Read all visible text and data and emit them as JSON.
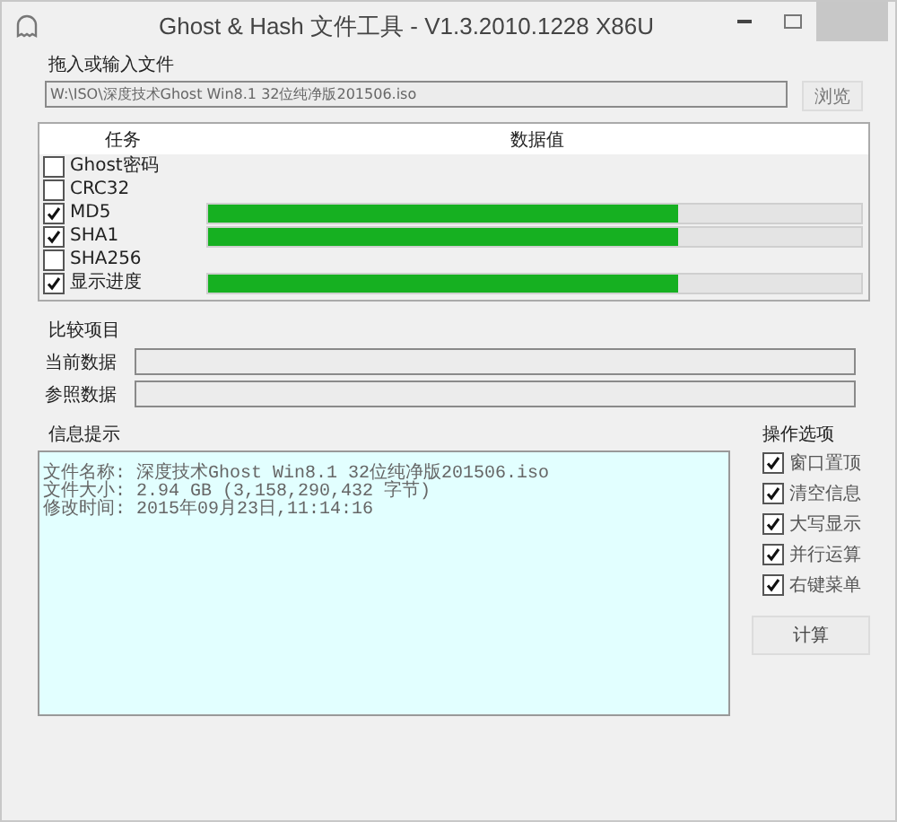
{
  "window": {
    "title": "Ghost & Hash 文件工具 - V1.3.2010.1228 X86U"
  },
  "file": {
    "label": "拖入或输入文件",
    "value": "W:\\ISO\\深度技术Ghost Win8.1 32位纯净版201506.iso",
    "browse": "浏览"
  },
  "tasks": {
    "columns": [
      "任务",
      "数据值"
    ],
    "rows": [
      {
        "name": "Ghost密码",
        "checked": false
      },
      {
        "name": "CRC32",
        "checked": false
      },
      {
        "name": "MD5",
        "checked": true,
        "level": 0.72
      },
      {
        "name": "SHA1",
        "checked": true,
        "level": 0.72
      },
      {
        "name": "SHA256",
        "checked": false
      },
      {
        "name": "显示进度",
        "checked": true,
        "level": 0.72
      }
    ]
  },
  "compare": {
    "title": "比较项目",
    "fields": [
      {
        "label": "当前数据"
      },
      {
        "label": "参照数据"
      }
    ]
  },
  "info": {
    "title": "信息提示",
    "lines": [
      "文件名称: 深度技术Ghost Win8.1 32位纯净版201506.iso",
      "文件大小: 2.94 GB (3,158,290,432 字节)",
      "修改时间: 2015年09月23日,11:14:16"
    ]
  },
  "options": {
    "title": "操作选项",
    "items": [
      {
        "label": "窗口置顶",
        "checked": true
      },
      {
        "label": "清空信息",
        "checked": true
      },
      {
        "label": "大写显示",
        "checked": true
      },
      {
        "label": "并行运算",
        "checked": true
      },
      {
        "label": "右键菜单",
        "checked": true
      }
    ],
    "button": "计算"
  }
}
